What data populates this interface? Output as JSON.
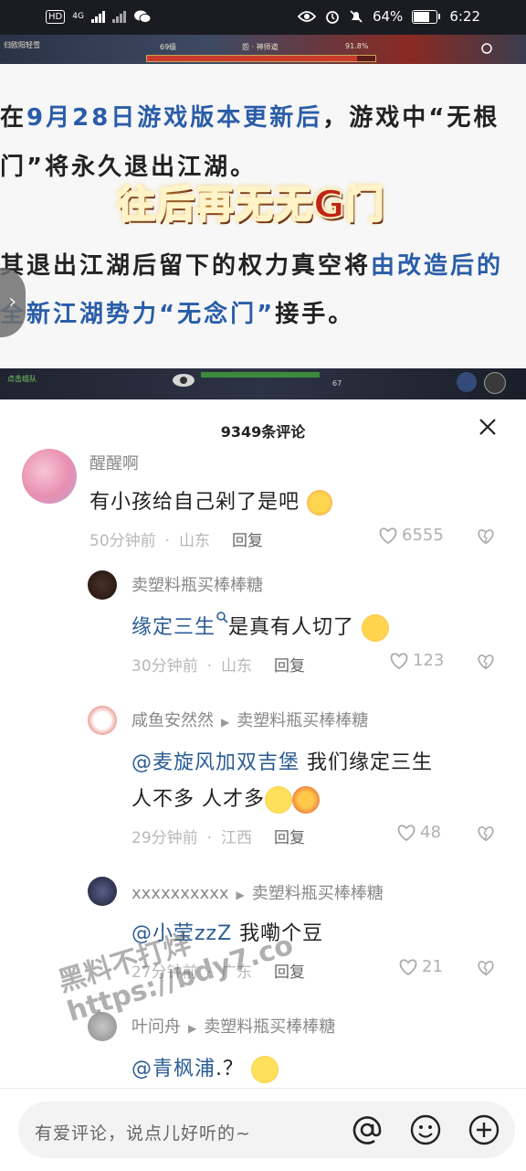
{
  "status_bar": {
    "hd_label": "HD",
    "network": "4G",
    "battery_percent": "64%",
    "battery_level": 0.64,
    "time": "6:22"
  },
  "game_top": {
    "left_text": "归欧阳轻雪",
    "level": "69级",
    "center_text": "怨 · 神师道",
    "percent": "91.8%",
    "hp_fraction": 0.918
  },
  "article": {
    "line1_prefix": "在",
    "line1_highlight": "9月28日游戏版本更新后",
    "line1_suffix": "，游戏中“无根",
    "line2": "门”将永久退出江湖。",
    "stamp": "往后再无无G门",
    "line3_prefix": "其退出江湖后留下的权力真空将",
    "line3_highlight": "由改造后的",
    "line4_highlight": "全新江湖势力“无念门”",
    "line4_suffix": "接手。"
  },
  "game_bottom": {
    "left_text": "点击组队",
    "level_small": "67"
  },
  "panel": {
    "title": "9349条评论"
  },
  "comments": [
    {
      "name": "醒醒啊",
      "text": "有小孩给自己剁了是吧",
      "time": "50分钟前",
      "location": "山东",
      "reply": "回复",
      "likes": "6555"
    },
    {
      "name": "卖塑料瓶买棒棒糖",
      "text": "缘定三生",
      "text_suffix": "是真有人切了",
      "time": "30分钟前",
      "location": "山东",
      "reply": "回复",
      "likes": "123"
    },
    {
      "name": "咸鱼安然然",
      "reply_to": "卖塑料瓶买棒棒糖",
      "mention": "@麦旋风加双吉堡",
      "text": " 我们缘定三生",
      "text2": "人不多 人才多",
      "time": "29分钟前",
      "location": "江西",
      "reply": "回复",
      "likes": "48"
    },
    {
      "name": "xxxxxxxxxx",
      "reply_to": "卖塑料瓶买棒棒糖",
      "mention": "@小莹zzZ",
      "text": " 我嘞个豆",
      "time": "27分钟前",
      "location": "广东",
      "reply": "回复",
      "likes": "21"
    },
    {
      "name": "叶问舟",
      "reply_to": "卖塑料瓶买棒棒糖",
      "mention": "@青枫浦",
      "text": ".？"
    }
  ],
  "input_bar": {
    "placeholder": "有爱评论，说点儿好听的~"
  },
  "watermark": {
    "line1": "黑料不打烊",
    "line2": "https://bdy7.co"
  }
}
